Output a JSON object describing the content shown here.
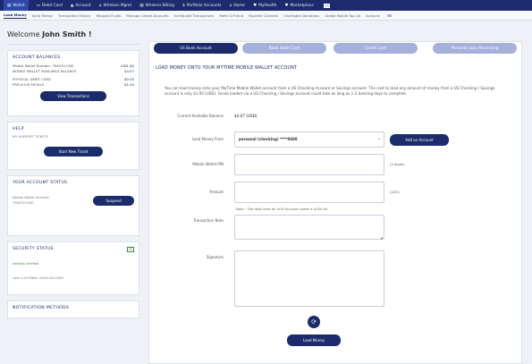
{
  "topnav": {
    "items": [
      {
        "icon": "▤",
        "label": "Wallet"
      },
      {
        "icon": "▭",
        "label": "Debit Card"
      },
      {
        "icon": "▲",
        "label": "Account"
      },
      {
        "icon": "⌂",
        "label": "Wireless Mgmt"
      },
      {
        "icon": "▤",
        "label": "Wireless Billing"
      },
      {
        "icon": "$",
        "label": "Portfolio Accounts"
      },
      {
        "icon": "⌂",
        "label": "Home"
      },
      {
        "icon": "♥",
        "label": "MyHealth"
      },
      {
        "icon": "♥",
        "label": "Marketplace"
      }
    ]
  },
  "subnav": {
    "items": [
      "Load Money",
      "Send Money",
      "Transaction History",
      "Request Funds",
      "Manage Linked Accounts",
      "Scheduled Transactions",
      "Refer A Friend",
      "Favorite Contacts",
      "Charitable Donations",
      "Global Mobile Top Up",
      "Account"
    ]
  },
  "left": {
    "welcome_prefix": "Welcome",
    "welcome_name": "John Smith !",
    "balances": {
      "title": "ACCOUNT BALANCES",
      "rows": [
        {
          "label": "Mobile Wallet Number: 7945321390",
          "value": "USD ($)"
        },
        {
          "label": "MOBILE WALLET AVAILABLE BALANCE",
          "value": "$4.07"
        },
        {
          "label": "PHYSICAL DEBIT CARD",
          "value": "$0.00"
        },
        {
          "label": "PRECIOUS METALS",
          "value": "$1.00"
        }
      ],
      "button": "View Transactions"
    },
    "help": {
      "title": "HELP",
      "link": "MY SUPPORT TICKETS",
      "button": "Start New Ticket"
    },
    "status": {
      "title": "YOUR ACCOUNT STATUS",
      "label": "Mobile Wallet Account 7945321390",
      "button": "Suspend"
    },
    "security": {
      "title": "SECURITY STATUS",
      "badge": "ID",
      "verified": "Identity Verified",
      "ssn": "Last 4 of SSN#: XXXX-XX-3099"
    },
    "notifications": {
      "title": "NOTIFICATION METHODS"
    }
  },
  "tabs": [
    "US Bank Account",
    "Book Debit Card",
    "Credit Card",
    "Personal Loan Processing"
  ],
  "form": {
    "section_title": "LOAD MONEY ONTO YOUR MYTIME MOBILE WALLET ACCOUNT",
    "description": "You can load money onto your MyTime Mobile Wallet account from a US Checking Account or Savings account. The cost to load any amount of money from a US Checking / Savings account is only $1.00 (USD). Funds loaded via a US Checking / Savings account could take as long as 1-2 banking days to complete.",
    "balance_label": "Current Available Balance",
    "balance_value": "$4.07 (USD)",
    "load_from_label": "Load Money From",
    "load_from_value": "personal (checking) ****0680",
    "add_account": "Add an Account",
    "pin_label": "Mobile Wallet PIN",
    "pin_hint": "(4 digits)",
    "amount_label": "Amount",
    "amount_unit": "(USD)",
    "amount_note": "Note : The daily limit for ACH Account Loads is $250.00",
    "note_label": "Transaction Note",
    "signature_label": "Signature",
    "refresh_icon": "⟳",
    "submit": "Load Money"
  }
}
